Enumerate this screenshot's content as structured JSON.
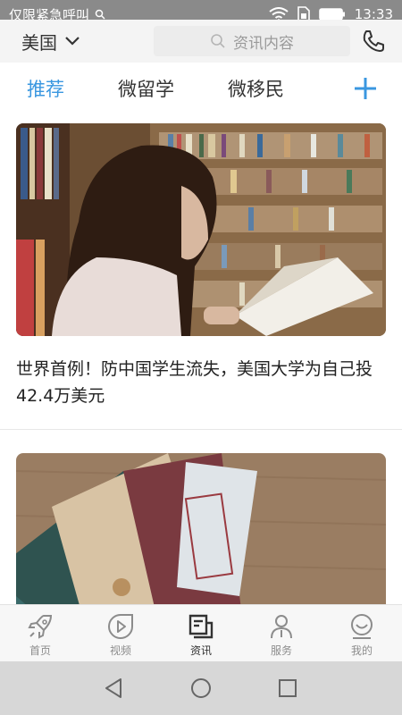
{
  "status_bar": {
    "carrier": "仅限紧急呼叫",
    "time": "13:33"
  },
  "header": {
    "country": "美国",
    "search_placeholder": "资讯内容"
  },
  "tabs": [
    {
      "label": "推荐",
      "active": true
    },
    {
      "label": "微留学",
      "active": false
    },
    {
      "label": "微移民",
      "active": false
    }
  ],
  "feed": [
    {
      "title": "世界首例！防中国学生流失，美国大学为自己投42.4万美元",
      "image": "girl-reading-in-library"
    },
    {
      "image": "envelopes-on-wood"
    }
  ],
  "bottom_nav": [
    {
      "label": "首页",
      "icon": "rocket-icon",
      "active": false
    },
    {
      "label": "视频",
      "icon": "play-icon",
      "active": false
    },
    {
      "label": "资讯",
      "icon": "news-icon",
      "active": true
    },
    {
      "label": "服务",
      "icon": "person-icon",
      "active": false
    },
    {
      "label": "我的",
      "icon": "smile-icon",
      "active": false
    }
  ],
  "colors": {
    "accent": "#3a97e0",
    "status_bar": "#8a8a8a",
    "header_bg": "#f4f4f4"
  }
}
